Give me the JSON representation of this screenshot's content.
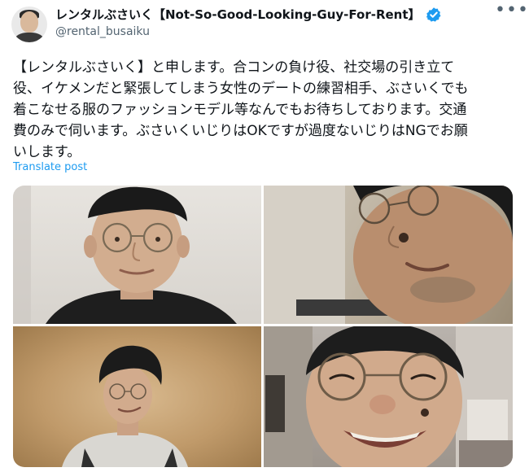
{
  "author": {
    "display_name": "レンタルぶさいく【Not-So-Good-Looking-Guy-For-Rent】",
    "handle": "@rental_busaiku",
    "verified": true,
    "avatar_icon": "profile-photo"
  },
  "tweet": {
    "text": "【レンタルぶさいく】と申します。合コンの負け役、社交場の引き立て\n役、イケメンだと緊張してしまう女性のデートの練習相手、ぶさいくでも\n着こなせる服のファッションモデル等なんでもお待ちしております。交通\n費のみで伺います。ぶさいくいじりはOKですが過度ないじりはNGでお願\nいします。",
    "translate_label": "Translate post"
  },
  "menu_icon": "more-horizontal-icon",
  "colors": {
    "link": "#1d9bf0",
    "verified": "#1d9bf0",
    "secondary_text": "#536471"
  },
  "media": {
    "photos": [
      {
        "icon": "photo-selfie-glasses-plain-wall"
      },
      {
        "icon": "photo-selfie-glasses-close-up"
      },
      {
        "icon": "photo-portrait-sepia-backdrop"
      },
      {
        "icon": "photo-grinning-glasses-kitchen"
      }
    ]
  }
}
